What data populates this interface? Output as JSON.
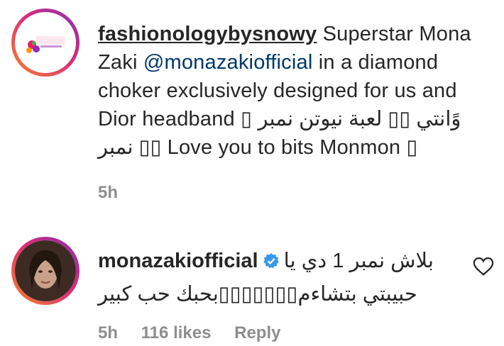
{
  "post": {
    "username": "fashionologybysnowy",
    "text_1": " Superstar Mona Zaki ",
    "mention": "@monazakiofficial",
    "text_2": " in a diamond choker exclusively designed for us and Dior headband ▯ وًانتي ▯▯ لعبة نيوتن نمبر",
    "text_3": "نمبر ▯▯ Love you to bits Monmon ▯",
    "time": "5h",
    "avatar_logo_text": "fashionology by snowy"
  },
  "comment": {
    "username": "monazakiofficial",
    "text": "بلاش نمبر 1 دي يا حبيبتي بتشاءم▯▯▯▯▯▯▯بحبك حب كبير",
    "time": "5h",
    "likes": "116 likes",
    "reply_label": "Reply"
  },
  "icons": {
    "verified": "verified-badge-icon",
    "heart": "heart-icon"
  },
  "colors": {
    "ring_start": "#f58529",
    "ring_end": "#8134af",
    "verified": "#3897f0",
    "meta": "#8e8e8e",
    "mention": "#00376b"
  }
}
